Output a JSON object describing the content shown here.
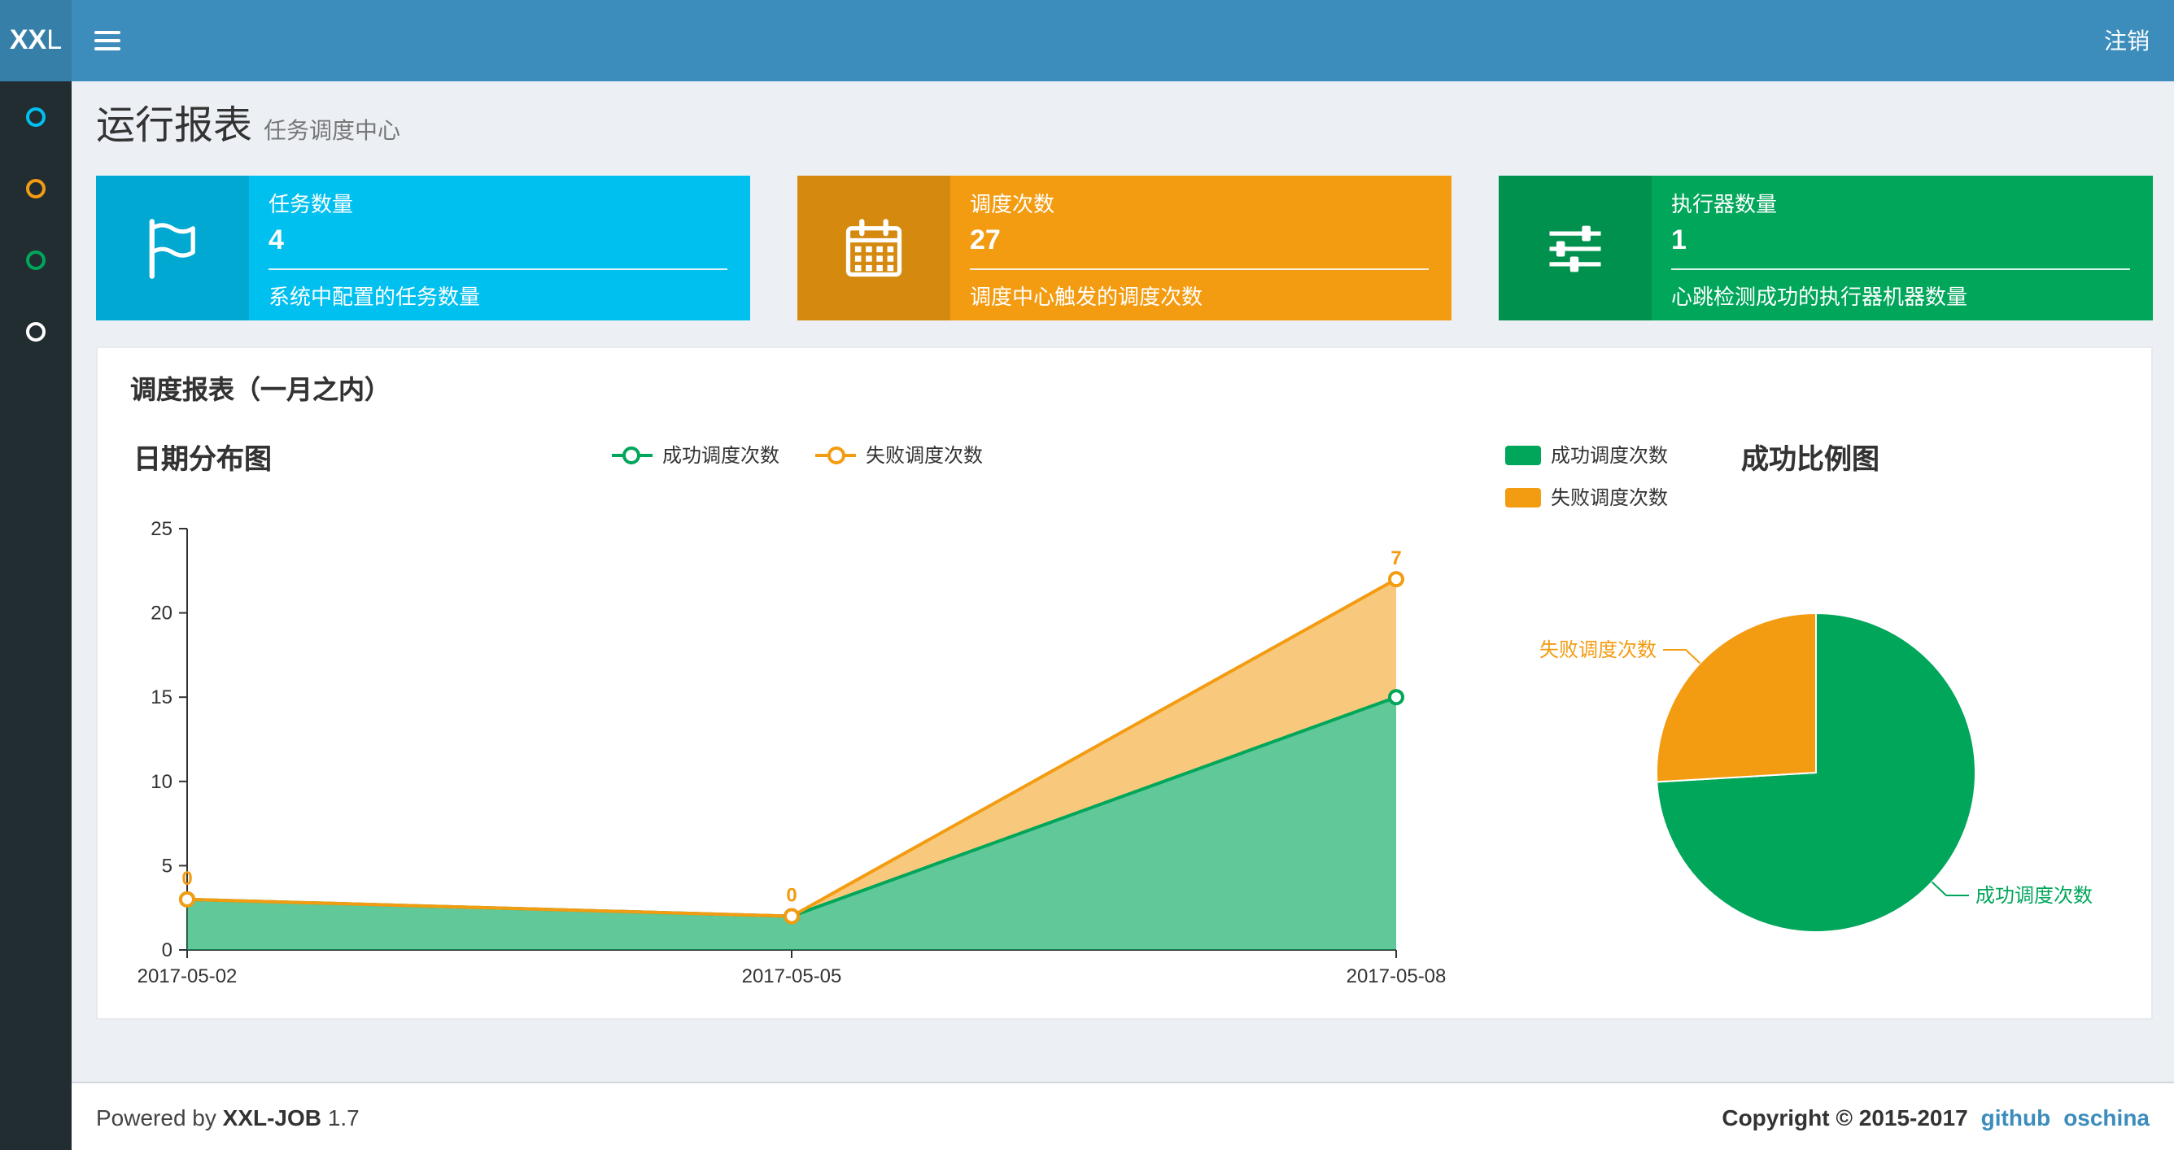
{
  "navbar": {
    "logo_bold": "XX",
    "logo_light": "L",
    "logout_label": "注销",
    "bg": "#3c8dbc",
    "logo_bg": "#367fa9"
  },
  "sidebar": {
    "bg": "#222d32",
    "items": [
      {
        "icon": "circle-outline-icon",
        "color": "#00c0ef"
      },
      {
        "icon": "circle-outline-icon",
        "color": "#f39c12"
      },
      {
        "icon": "circle-outline-icon",
        "color": "#00a65a"
      },
      {
        "icon": "circle-outline-icon",
        "color": "#ffffff"
      }
    ]
  },
  "header": {
    "title": "运行报表",
    "subtitle": "任务调度中心"
  },
  "info_boxes": [
    {
      "label": "任务数量",
      "value": "4",
      "desc": "系统中配置的任务数量",
      "bg": "#00c0ef",
      "icon": "flag-icon"
    },
    {
      "label": "调度次数",
      "value": "27",
      "desc": "调度中心触发的调度次数",
      "bg": "#f39c12",
      "icon": "calendar-icon"
    },
    {
      "label": "执行器数量",
      "value": "1",
      "desc": "心跳检测成功的执行器机器数量",
      "bg": "#00a65a",
      "icon": "sliders-icon"
    }
  ],
  "panel": {
    "title": "调度报表（一月之内）"
  },
  "chart_data": [
    {
      "type": "area",
      "title": "日期分布图",
      "x": [
        "2017-05-02",
        "2017-05-05",
        "2017-05-08"
      ],
      "stacked": true,
      "series": [
        {
          "name": "成功调度次数",
          "values": [
            3,
            2,
            15
          ],
          "color": "#00a65a"
        },
        {
          "name": "失败调度次数",
          "values": [
            0,
            0,
            7
          ],
          "color": "#f39c12"
        }
      ],
      "point_labels_series": "失败调度次数",
      "point_labels": [
        "0",
        "0",
        "7"
      ],
      "ylim": [
        0,
        25
      ],
      "yticks": [
        0,
        5,
        10,
        15,
        20,
        25
      ],
      "legend_position": "top-center",
      "grid": false
    },
    {
      "type": "pie",
      "title": "成功比例图",
      "slices": [
        {
          "name": "成功调度次数",
          "value": 20,
          "color": "#00a65a"
        },
        {
          "name": "失败调度次数",
          "value": 7,
          "color": "#f39c12"
        }
      ],
      "legend_position": "top-left"
    }
  ],
  "footer": {
    "powered_by": "Powered by",
    "brand": "XXL-JOB",
    "version": "1.7",
    "copyright": "Copyright © 2015-2017",
    "links": [
      {
        "label": "github"
      },
      {
        "label": "oschina"
      }
    ],
    "link_color": "#3c8dbc"
  }
}
